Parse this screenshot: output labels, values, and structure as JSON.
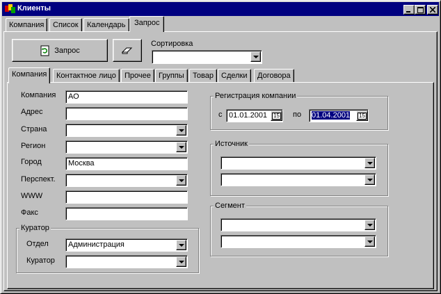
{
  "window": {
    "title": "Клиенты",
    "icon": "app-icon"
  },
  "window_buttons": {
    "minimize": "_",
    "maximize": "□",
    "close": "×"
  },
  "top_tabs": [
    "Компания",
    "Список",
    "Календарь",
    "Запрос"
  ],
  "toolbar": {
    "query_label": "Запрос",
    "query_icon": "refresh-icon",
    "clear_icon": "eraser-icon"
  },
  "sorting": {
    "label": "Сортировка",
    "value": ""
  },
  "inner_tabs": [
    "Компания",
    "Контактное лицо",
    "Прочее",
    "Группы",
    "Товар",
    "Сделки",
    "Договора"
  ],
  "company_fields": {
    "company": {
      "label": "Компания",
      "value": "АО"
    },
    "address": {
      "label": "Адрес",
      "value": ""
    },
    "country": {
      "label": "Страна",
      "value": ""
    },
    "region": {
      "label": "Регион",
      "value": ""
    },
    "city": {
      "label": "Город",
      "value": "Москва"
    },
    "prospect": {
      "label": "Перспект.",
      "value": ""
    },
    "www": {
      "label": "WWW",
      "value": ""
    },
    "fax": {
      "label": "Факс",
      "value": ""
    }
  },
  "curator_group": {
    "title": "Куратор",
    "department": {
      "label": "Отдел",
      "value": "Администрация"
    },
    "curator": {
      "label": "Куратор",
      "value": ""
    }
  },
  "registration": {
    "title": "Регистрация компании",
    "from_label": "с",
    "from_value": "01.01.2001",
    "to_label": "по",
    "to_value": "01.04.2001",
    "calendar_button": "15"
  },
  "source": {
    "title": "Источник",
    "value1": "",
    "value2": ""
  },
  "segment": {
    "title": "Сегмент",
    "value1": "",
    "value2": ""
  }
}
